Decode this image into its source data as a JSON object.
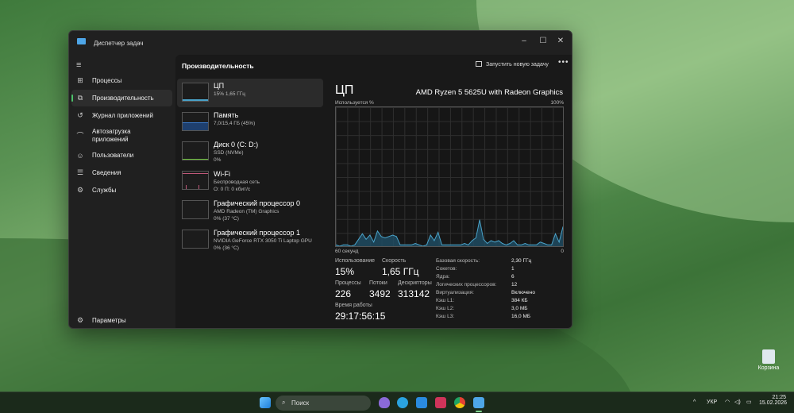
{
  "window": {
    "title": "Диспетчер задач",
    "minimize": "–",
    "maximize": "☐",
    "close": "✕"
  },
  "sidebar": {
    "menu": "≡",
    "items": [
      {
        "label": "Процессы",
        "icon": "processes-icon",
        "glyph": "⊞"
      },
      {
        "label": "Производительность",
        "icon": "performance-icon",
        "glyph": "⧉"
      },
      {
        "label": "Журнал приложений",
        "icon": "history-icon",
        "glyph": "↺"
      },
      {
        "label": "Автозагрузка приложений",
        "icon": "startup-icon",
        "glyph": "⌒"
      },
      {
        "label": "Пользователи",
        "icon": "users-icon",
        "glyph": "☺"
      },
      {
        "label": "Сведения",
        "icon": "details-icon",
        "glyph": "☰"
      },
      {
        "label": "Службы",
        "icon": "services-icon",
        "glyph": "⚙"
      }
    ],
    "settings": {
      "label": "Параметры",
      "glyph": "⚙"
    }
  },
  "header": {
    "title": "Производительность",
    "new_task": "Запустить новую задачу",
    "more": "•••"
  },
  "resources": [
    {
      "name": "ЦП",
      "lines": [
        "15%  1,65 ГГц"
      ]
    },
    {
      "name": "Память",
      "lines": [
        "7,0/15,4 ГБ (45%)"
      ]
    },
    {
      "name": "Диск 0 (C: D:)",
      "lines": [
        "SSD (NVMe)",
        "0%"
      ]
    },
    {
      "name": "Wi-Fi",
      "lines": [
        "Беспроводная сеть",
        "О: 0 П: 0 кбит/с"
      ]
    },
    {
      "name": "Графический процессор 0",
      "lines": [
        "AMD Radeon (TM) Graphics",
        "0% (37 °C)"
      ]
    },
    {
      "name": "Графический процессор 1",
      "lines": [
        "NVIDIA GeForce RTX 3050 Ti Laptop GPU",
        "0% (36 °C)"
      ]
    }
  ],
  "detail": {
    "title": "ЦП",
    "model": "AMD Ryzen 5 5625U with Radeon Graphics",
    "y_label": "Используется %",
    "y_max": "100%",
    "x_label": "60 секунд",
    "x_min": "0",
    "stats": {
      "usage_label": "Использование",
      "usage": "15%",
      "speed_label": "Скорость",
      "speed": "1,65 ГГц",
      "proc_label": "Процессы",
      "proc": "226",
      "threads_label": "Потоки",
      "threads": "3492",
      "handles_label": "Дескрипторы",
      "handles": "313142",
      "uptime_label": "Время работы",
      "uptime": "29:17:56:15"
    },
    "specs": [
      [
        "Базовая скорость:",
        "2,30 ГГц"
      ],
      [
        "Сокетов:",
        "1"
      ],
      [
        "Ядра:",
        "6"
      ],
      [
        "Логических процессоров:",
        "12"
      ],
      [
        "Виртуализация:",
        "Включено"
      ],
      [
        "Кэш L1:",
        "384 КБ"
      ],
      [
        "Кэш L2:",
        "3,0 МБ"
      ],
      [
        "Кэш L3:",
        "16,0 МБ"
      ]
    ]
  },
  "chart_data": {
    "type": "area",
    "title": "ЦП",
    "ylabel": "Используется %",
    "xlabel": "60 секунд",
    "ylim": [
      0,
      100
    ],
    "x": "seconds ago 60→0",
    "color": "#4aa3c9",
    "values": [
      1,
      0,
      1,
      1,
      0,
      1,
      5,
      9,
      5,
      8,
      3,
      11,
      7,
      6,
      7,
      8,
      7,
      1,
      1,
      1,
      1,
      2,
      1,
      0,
      1,
      8,
      4,
      10,
      1,
      1,
      1,
      1,
      1,
      1,
      2,
      1,
      4,
      6,
      19,
      5,
      2,
      4,
      3,
      4,
      2,
      1,
      2,
      4,
      1,
      1,
      2,
      1,
      1,
      1,
      3,
      2,
      1,
      1,
      9,
      3,
      14
    ]
  },
  "taskbar": {
    "search": "Поиск",
    "lang": "УКР",
    "time": "21:25",
    "date": "15.02.2026",
    "chevron": "^"
  },
  "desktop": {
    "recycle_bin": "Корзина"
  }
}
